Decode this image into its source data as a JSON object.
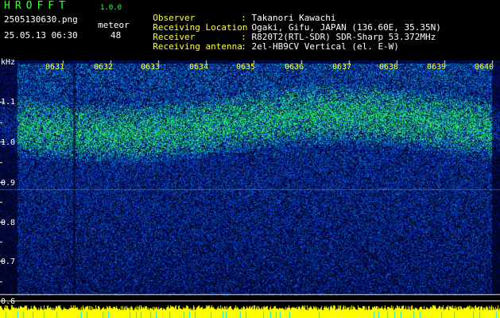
{
  "app": {
    "title": "HROFFT",
    "version": "1.0.0"
  },
  "file_name": "2505130630.png",
  "timestamp": "25.05.13 06:30",
  "mode": {
    "label": "meteor",
    "count": "48"
  },
  "info": [
    {
      "key": "Observer",
      "value": "Takanori Kawachi"
    },
    {
      "key": "Receiving Location",
      "value": "Ogaki, Gifu, JAPAN (136.60E, 35.35N)"
    },
    {
      "key": "Receiver",
      "value": "R820T2(RTL-SDR) SDR-Sharp 53.372MHz"
    },
    {
      "key": "Receiving antenna",
      "value": "2el-HB9CV Vertical (el. E-W)"
    }
  ],
  "axis": {
    "freq_unit": "kHz",
    "time_ticks": [
      "0631",
      "0632",
      "0633",
      "0634",
      "0635",
      "0636",
      "0637",
      "0638",
      "0639",
      "0640"
    ],
    "freq_ticks": [
      "1.1",
      "1.0",
      "0.9",
      "0.8",
      "0.7",
      "0.6"
    ],
    "freq_minor_ticks": [
      "1.05",
      "0.95",
      "0.85",
      "0.75",
      "0.65"
    ]
  },
  "colors": {
    "title_green": "#3cff3c",
    "label_yellow": "#ffff40",
    "background": "#000000",
    "spectrum_low": "#0a1a70",
    "spectrum_high": "#40ff60",
    "level_bar": "#ffff00",
    "level_marks": "#00e8ff"
  }
}
